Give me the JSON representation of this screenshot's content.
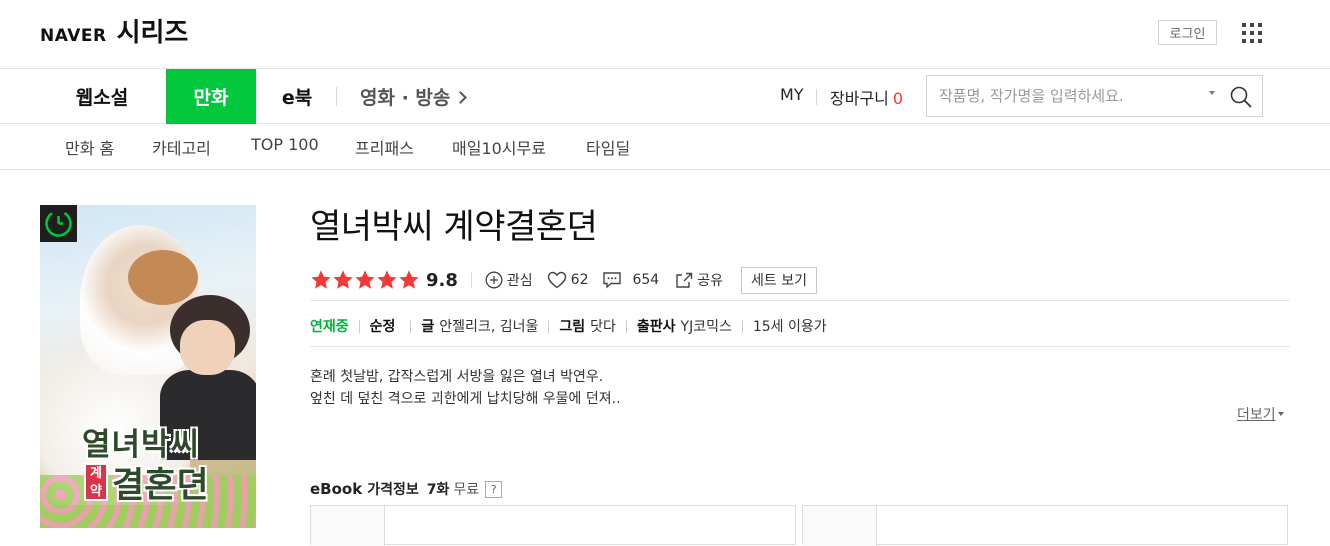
{
  "header": {
    "brand_naver": "NAVER",
    "brand_series": "시리즈",
    "login_label": "로그인",
    "apps_icon": "grid-icon"
  },
  "gnb": {
    "tabs": [
      {
        "label": "웹소설",
        "active": false
      },
      {
        "label": "만화",
        "active": true
      },
      {
        "label": "e북",
        "active": false
      },
      {
        "label": "영화 · 방송",
        "active": false
      }
    ],
    "my_label": "MY",
    "cart_label": "장바구니",
    "cart_count": "0",
    "search_placeholder": "작품명, 작가명을 입력하세요.",
    "accent_color": "#00c73c"
  },
  "lnb": {
    "items": [
      "만화 홈",
      "카테고리",
      "TOP 100",
      "프리패스",
      "매일10시무료",
      "타임딜"
    ]
  },
  "work": {
    "title": "열녀박씨 계약결혼뎐",
    "cover_title_line1": "열녀박씨",
    "cover_badge": "계약",
    "cover_title_line2": "결혼뎐",
    "rating_stars": 5,
    "rating_score": "9.8",
    "interest_label": "관심",
    "likes": "62",
    "comments": "654",
    "share_label": "공유",
    "set_view_label": "세트 보기",
    "status": "연재중",
    "genre": "순정",
    "writer_label": "글",
    "writer": "안젤리크, 김너울",
    "artist_label": "그림",
    "artist": "닷다",
    "publisher_label": "출판사",
    "publisher": "YJ코믹스",
    "age": "15세 이용가",
    "synopsis_line1": "혼례 첫날밤, 갑작스럽게 서방을 잃은 열녀 박연우.",
    "synopsis_line2": "엎친 데 덮친 격으로 괴한에게 납치당해 우물에 던져..",
    "more_label": "더보기"
  },
  "price": {
    "ebook_label": "eBook",
    "info_label": "가격정보",
    "free_count": "7화",
    "free_label": "무료",
    "help": "?"
  }
}
